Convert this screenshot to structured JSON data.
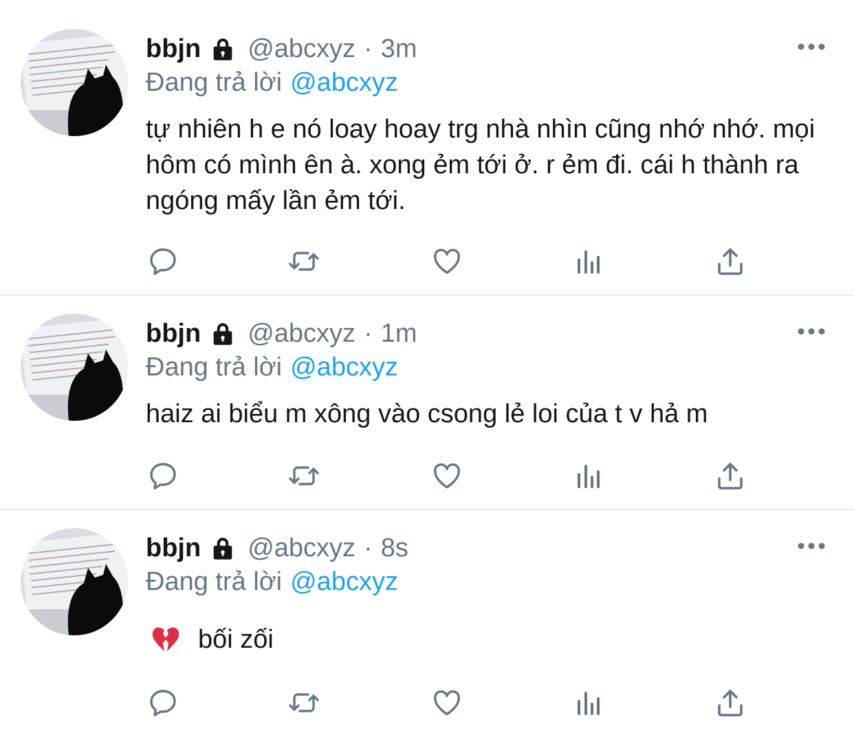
{
  "colors": {
    "text_primary": "#14171a",
    "text_secondary": "#657786",
    "mention": "#1da1f2",
    "icon": "#657786",
    "divider": "#e6ecf0"
  },
  "tweets": [
    {
      "name": "bbjn",
      "lock_icon": "lock-icon",
      "handle": "@abcxyz",
      "separator": "·",
      "time": "3m",
      "reply_prefix": "Đang trả lời",
      "reply_to": "@abcxyz",
      "text": "tự nhiên h e nó loay hoay trg nhà nhìn cũng nhớ nhớ. mọi hôm có mình ên à. xong ẻm tới ở. r ẻm đi. cái h thành ra ngóng mấy lần ẻm tới."
    },
    {
      "name": "bbjn",
      "lock_icon": "lock-icon",
      "handle": "@abcxyz",
      "separator": "·",
      "time": "1m",
      "reply_prefix": "Đang trả lời",
      "reply_to": "@abcxyz",
      "text": "haiz ai biểu m xông vào csong lẻ loi của t v hả m"
    },
    {
      "name": "bbjn",
      "lock_icon": "lock-icon",
      "handle": "@abcxyz",
      "separator": "·",
      "time": "8s",
      "reply_prefix": "Đang trả lời",
      "reply_to": "@abcxyz",
      "emoji": "broken-heart-icon",
      "text": "bối zối"
    }
  ],
  "action_icons": [
    "reply-icon",
    "retweet-icon",
    "like-icon",
    "analytics-icon",
    "share-icon"
  ],
  "more_icon": "more-options-icon"
}
